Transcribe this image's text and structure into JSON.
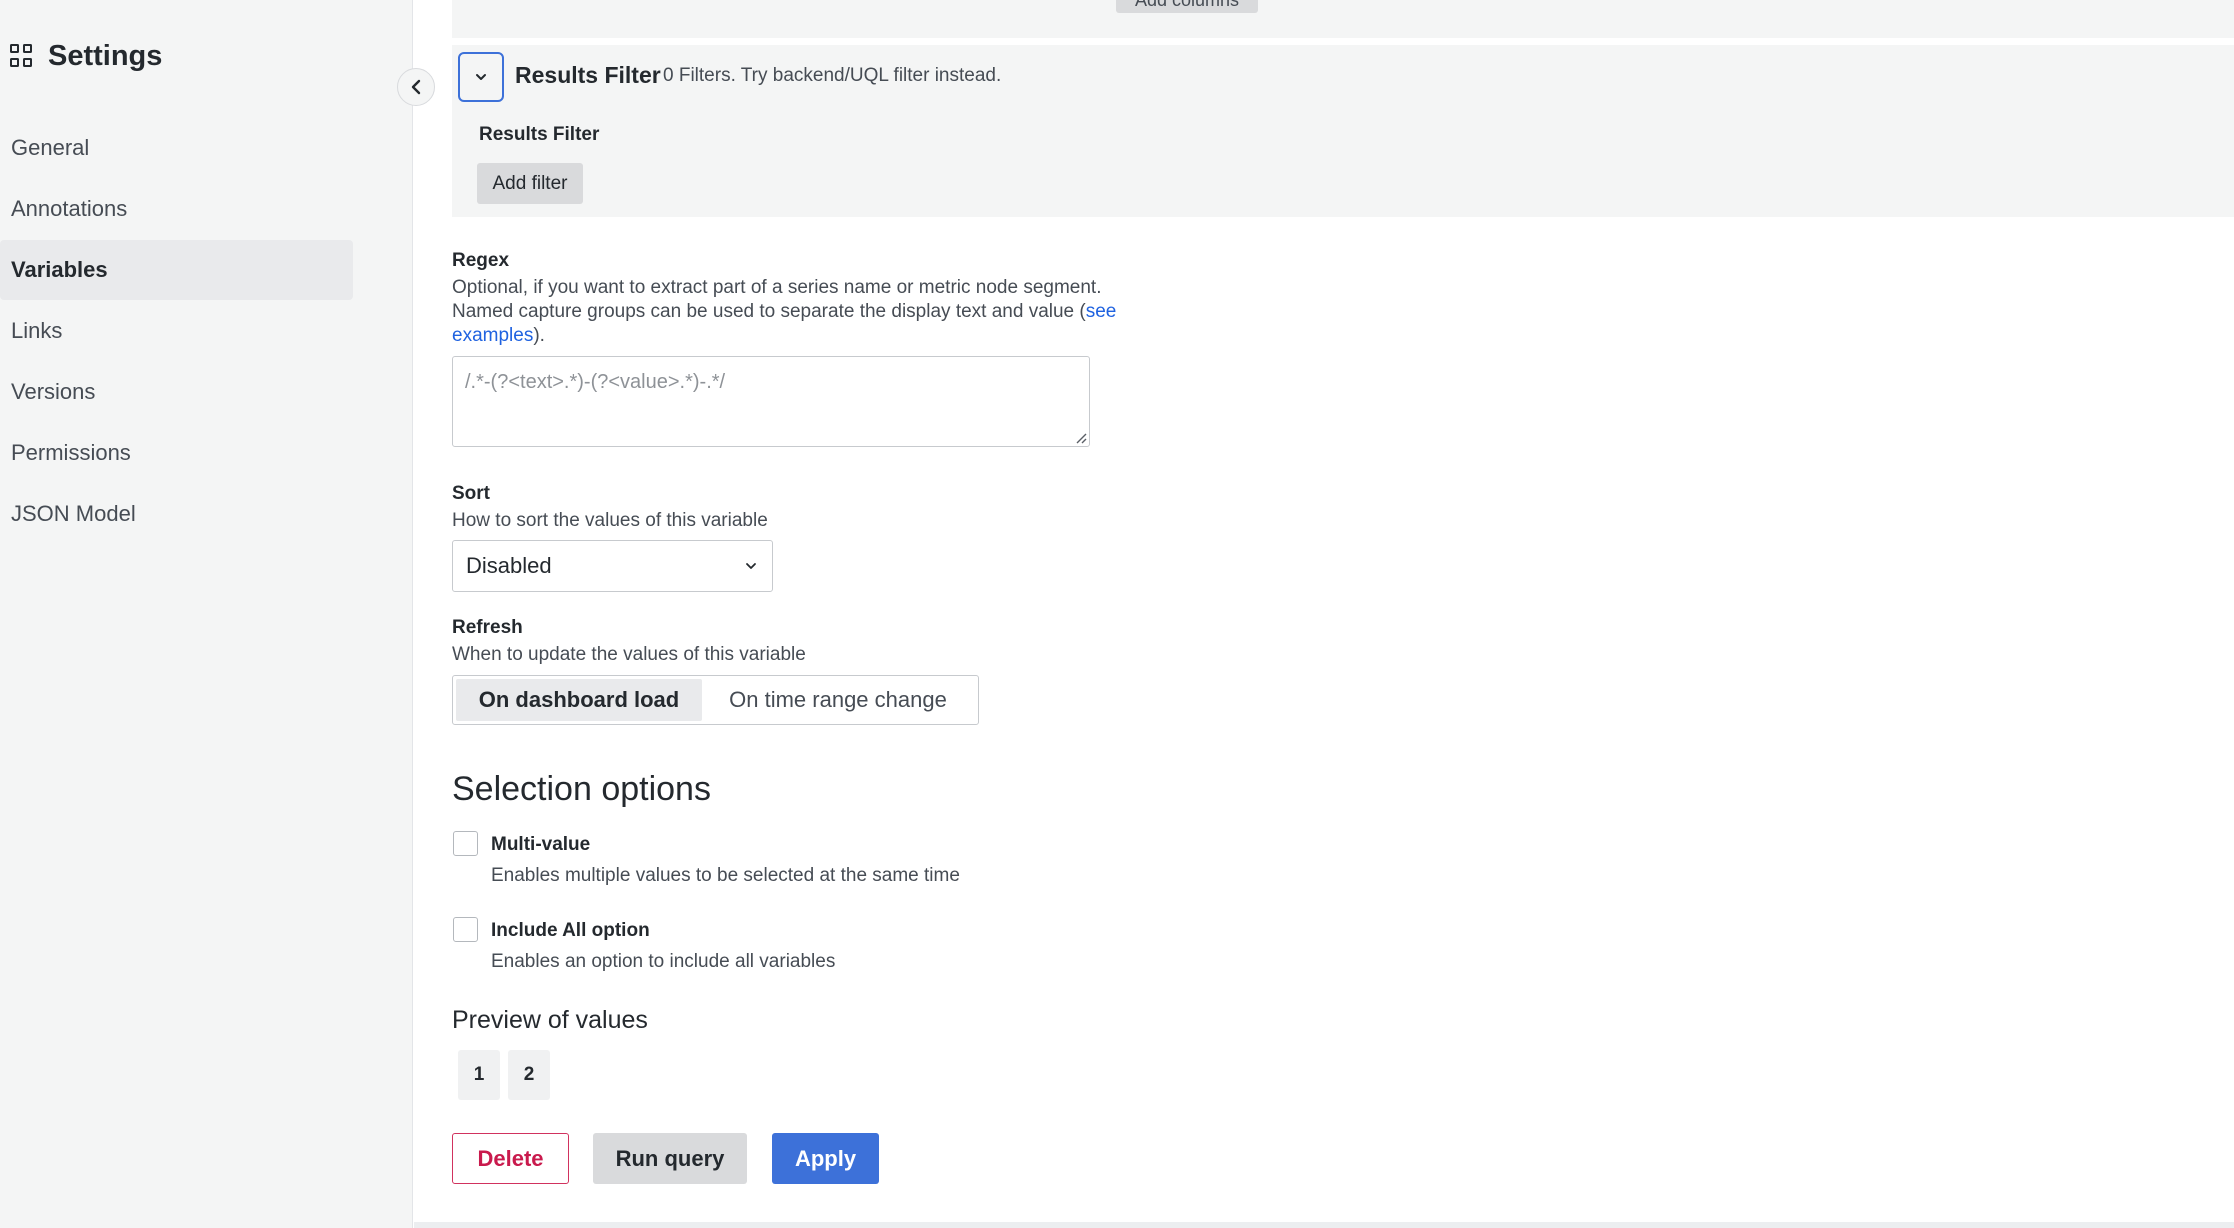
{
  "sidebar": {
    "title": "Settings",
    "icon": "grid-icon",
    "items": [
      {
        "label": "General",
        "active": false
      },
      {
        "label": "Annotations",
        "active": false
      },
      {
        "label": "Variables",
        "active": true
      },
      {
        "label": "Links",
        "active": false
      },
      {
        "label": "Versions",
        "active": false
      },
      {
        "label": "Permissions",
        "active": false
      },
      {
        "label": "JSON Model",
        "active": false
      }
    ],
    "collapse_icon": "chevron-left-icon"
  },
  "results_filter": {
    "title": "Results Filter",
    "description": "0 Filters. Try backend/UQL filter instead.",
    "label": "Results Filter",
    "add_filter_label": "Add filter",
    "toggle_icon": "chevron-down-icon"
  },
  "top_button_label": "Add columns",
  "regex": {
    "label": "Regex",
    "desc_line1": "Optional, if you want to extract part of a series name or metric node segment.",
    "desc_line2_prefix": "Named capture groups can be used to separate the display text and value (",
    "link_part1": "see",
    "link_part2": "examples",
    "desc_suffix": ").",
    "placeholder": "/.*-(?<text>.*)-(?<value>.*)-.*/",
    "value": ""
  },
  "sort": {
    "label": "Sort",
    "description": "How to sort the values of this variable",
    "selected": "Disabled"
  },
  "refresh": {
    "label": "Refresh",
    "description": "When to update the values of this variable",
    "options": [
      "On dashboard load",
      "On time range change"
    ],
    "selected": "On dashboard load"
  },
  "selection_options": {
    "title": "Selection options",
    "multi_value": {
      "label": "Multi-value",
      "description": "Enables multiple values to be selected at the same time",
      "checked": false
    },
    "include_all": {
      "label": "Include All option",
      "description": "Enables an option to include all variables",
      "checked": false
    }
  },
  "preview": {
    "title": "Preview of values",
    "values": [
      "1",
      "2"
    ]
  },
  "actions": {
    "delete": "Delete",
    "run_query": "Run query",
    "apply": "Apply"
  },
  "colors": {
    "primary": "#3d71d9",
    "danger": "#c91a4d",
    "sidebar_bg": "#f4f5f5"
  }
}
